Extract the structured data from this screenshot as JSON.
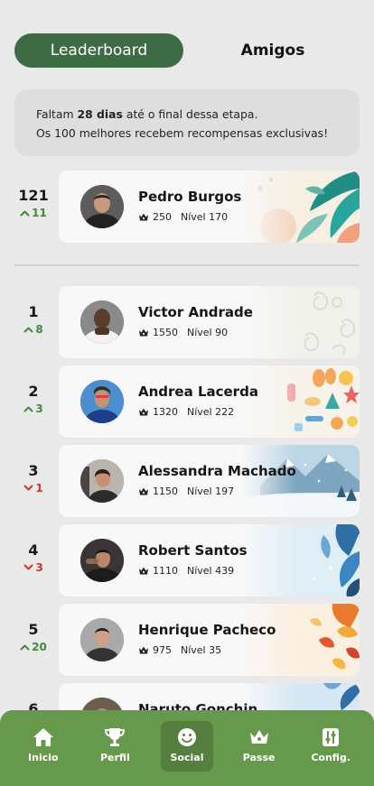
{
  "tabs": {
    "leaderboard": "Leaderboard",
    "friends": "Amigos",
    "active": "Leaderboard"
  },
  "info": {
    "line1_prefix": "Faltam ",
    "line1_days": "28 dias",
    "line1_suffix": " até o final dessa etapa.",
    "line2": "Os 100 melhores recebem recompensas exclusivas!"
  },
  "current_user": {
    "rank": "121",
    "change": "11",
    "direction": "up",
    "name": "Pedro Burgos",
    "points": "250",
    "level": "Nível 170",
    "art": "tropical-leaves"
  },
  "leaderboard": [
    {
      "rank": "1",
      "change": "8",
      "direction": "up",
      "name": "Victor Andrade",
      "points": "1550",
      "level": "Nível 90",
      "art": "damask-pattern"
    },
    {
      "rank": "2",
      "change": "3",
      "direction": "up",
      "name": "Andrea Lacerda",
      "points": "1320",
      "level": "Nível 222",
      "art": "summer-beach"
    },
    {
      "rank": "3",
      "change": "1",
      "direction": "down",
      "name": "Alessandra Machado",
      "points": "1150",
      "level": "Nível 197",
      "art": "snowy-mountains"
    },
    {
      "rank": "4",
      "change": "3",
      "direction": "down",
      "name": "Robert Santos",
      "points": "1110",
      "level": "Nível 439",
      "art": "blue-leaves"
    },
    {
      "rank": "5",
      "change": "20",
      "direction": "up",
      "name": "Henrique Pacheco",
      "points": "975",
      "level": "Nível 35",
      "art": "autumn-leaves"
    },
    {
      "rank": "6",
      "change": "",
      "direction": "up",
      "name": "Naruto Gonchin",
      "points": "",
      "level": "",
      "art": "blue-winter"
    }
  ],
  "nav": [
    {
      "label": "Inicio",
      "icon": "home-icon",
      "active": false
    },
    {
      "label": "Perfil",
      "icon": "trophy-icon",
      "active": false
    },
    {
      "label": "Social",
      "icon": "smiley-icon",
      "active": true
    },
    {
      "label": "Passe",
      "icon": "crown-icon",
      "active": false
    },
    {
      "label": "Config.",
      "icon": "sliders-icon",
      "active": false
    }
  ],
  "colors": {
    "primary": "#3d6b44",
    "nav_bg": "#67994c",
    "up": "#3f8a3c",
    "down": "#c53b33",
    "background": "#e9e9e9"
  }
}
